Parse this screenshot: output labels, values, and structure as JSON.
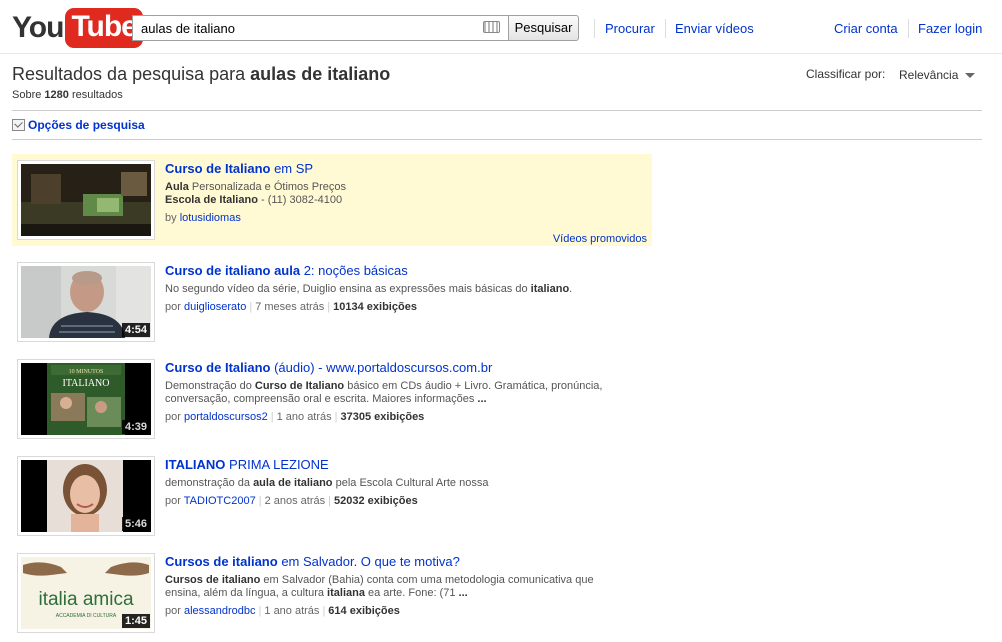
{
  "header": {
    "logo_you": "You",
    "logo_tube": "Tube",
    "search_value": "aulas de italiano",
    "search_button": "Pesquisar",
    "links": [
      "Procurar",
      "Enviar vídeos",
      "Criar conta",
      "Fazer login"
    ]
  },
  "results_header": {
    "title_prefix": "Resultados da pesquisa para ",
    "query": "aulas de italiano",
    "count_prefix": "Sobre ",
    "count": "1280",
    "count_suffix": " resultados",
    "sort_label": "Classificar por:",
    "sort_value": "Relevância",
    "search_options": "Opções de pesquisa"
  },
  "promoted": {
    "title_bold": "Curso de Italiano",
    "title_rest": " em SP",
    "line1_bold": "Aula",
    "line1_rest": " Personalizada e Ótimos Preços",
    "line2_bold": "Escola de Italiano",
    "line2_rest": " - (11) 3082-4100",
    "by": "by ",
    "author": "lotusidiomas",
    "label": "Vídeos promovidos"
  },
  "results": [
    {
      "title_parts": [
        {
          "text": "Curso de italiano aula",
          "bold": true
        },
        {
          "text": " 2: noções básicas",
          "bold": false
        }
      ],
      "desc_parts": [
        {
          "text": "No segundo vídeo da série, Duiglio ensina as expressões mais básicas do ",
          "bold": false
        },
        {
          "text": "italiano",
          "bold": true
        },
        {
          "text": ".",
          "bold": false
        }
      ],
      "by": "por ",
      "author": "duiglioserato",
      "age": "7 meses atrás",
      "views": "10134 exibições",
      "duration": "4:54"
    },
    {
      "title_parts": [
        {
          "text": "Curso de Italiano",
          "bold": true
        },
        {
          "text": " (áudio) - www.portaldoscursos.com.br",
          "bold": false
        }
      ],
      "desc_parts": [
        {
          "text": "Demonstração do ",
          "bold": false
        },
        {
          "text": "Curso de Italiano",
          "bold": true
        },
        {
          "text": " básico em CDs áudio + Livro. Gramática, pronúncia, conversação, compreensão oral e escrita. Maiores informações ",
          "bold": false
        },
        {
          "text": "...",
          "bold": true
        }
      ],
      "by": "por ",
      "author": "portaldoscursos2",
      "age": "1 ano atrás",
      "views": "37305 exibições",
      "duration": "4:39"
    },
    {
      "title_parts": [
        {
          "text": "ITALIANO",
          "bold": true
        },
        {
          "text": " PRIMA LEZIONE",
          "bold": false
        }
      ],
      "desc_parts": [
        {
          "text": "demonstração da ",
          "bold": false
        },
        {
          "text": "aula de italiano",
          "bold": true
        },
        {
          "text": " pela Escola Cultural Arte nossa",
          "bold": false
        }
      ],
      "by": "por ",
      "author": "TADIOTC2007",
      "age": "2 anos atrás",
      "views": "52032 exibições",
      "duration": "5:46"
    },
    {
      "title_parts": [
        {
          "text": "Cursos de italiano",
          "bold": true
        },
        {
          "text": " em Salvador. O que te motiva?",
          "bold": false
        }
      ],
      "desc_parts": [
        {
          "text": "Cursos de italiano",
          "bold": true
        },
        {
          "text": " em Salvador (Bahia) conta com uma metodologia comunicativa que ensina, além da língua, a cultura ",
          "bold": false
        },
        {
          "text": "italiana",
          "bold": true
        },
        {
          "text": " ea arte. Fone: (71 ",
          "bold": false
        },
        {
          "text": "...",
          "bold": true
        }
      ],
      "by": "por ",
      "author": "alessandrodbc",
      "age": "1 ano atrás",
      "views": "614 exibições",
      "duration": "1:45"
    }
  ],
  "thumb_texts": {
    "italia_amica": "italia amica",
    "accademia": "ACCADEMIA DI CULTURA",
    "dieci_minuti": "10 MINUTOS",
    "italiano_book": "ITALIANO"
  }
}
